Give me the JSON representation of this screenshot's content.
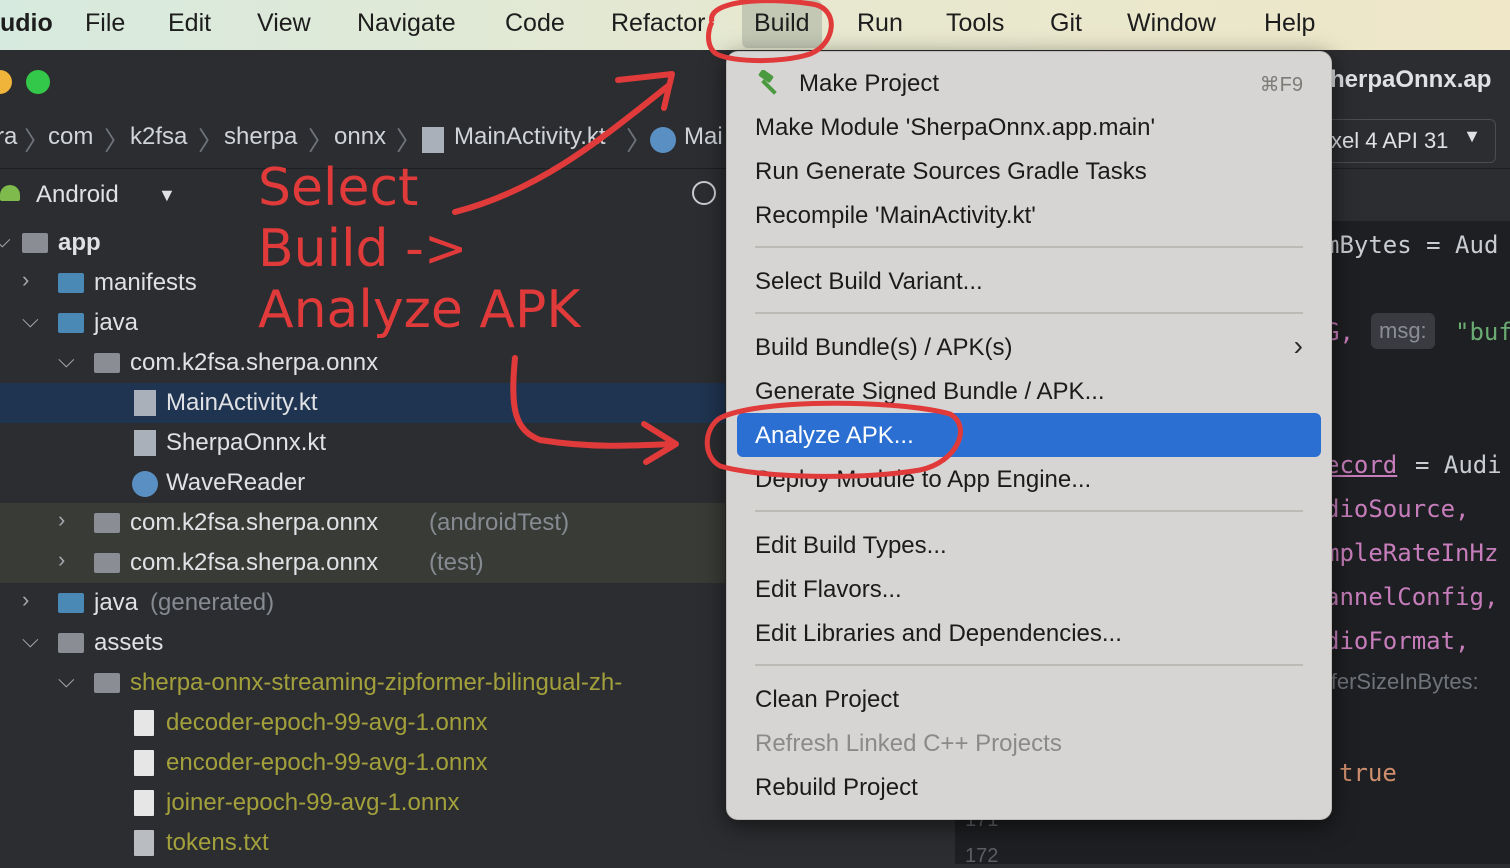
{
  "menubar": {
    "app": "udio",
    "items": [
      "File",
      "Edit",
      "View",
      "Navigate",
      "Code",
      "Refactor",
      "Build",
      "Run",
      "Tools",
      "Git",
      "Window",
      "Help"
    ]
  },
  "breadcrumb": [
    "ra",
    "com",
    "k2fsa",
    "sherpa",
    "onnx",
    "MainActivity.kt",
    "Mai"
  ],
  "editor_tab": "herpaOnnx.ap",
  "device_selector": "xel 4 API 31",
  "project_view": {
    "label": "Android"
  },
  "tree": [
    {
      "label": "app"
    },
    {
      "label": "manifests"
    },
    {
      "label": "java"
    },
    {
      "label": "com.k2fsa.sherpa.onnx"
    },
    {
      "label": "MainActivity.kt"
    },
    {
      "label": "SherpaOnnx.kt"
    },
    {
      "label": "WaveReader"
    },
    {
      "label": "com.k2fsa.sherpa.onnx",
      "suffix": "(androidTest)"
    },
    {
      "label": "com.k2fsa.sherpa.onnx",
      "suffix": "(test)"
    },
    {
      "label": "java",
      "suffix": "(generated)"
    },
    {
      "label": "assets"
    },
    {
      "label": "sherpa-onnx-streaming-zipformer-bilingual-zh-"
    },
    {
      "label": "decoder-epoch-99-avg-1.onnx"
    },
    {
      "label": "encoder-epoch-99-avg-1.onnx"
    },
    {
      "label": "joiner-epoch-99-avg-1.onnx"
    },
    {
      "label": "tokens.txt"
    }
  ],
  "code_lines": [
    "mBytes = Aud",
    "G,",
    "msg:",
    "\"buf",
    "ecord",
    "= Audi",
    "dioSource,",
    "mpleRateInHz",
    "annelConfig,",
    "dioFormat,",
    "fferSizeInBytes:",
    "true"
  ],
  "line_numbers": [
    "171",
    "172"
  ],
  "build_menu": {
    "make_project": "Make Project",
    "make_project_shortcut": "⌘F9",
    "make_module": "Make Module 'SherpaOnnx.app.main'",
    "run_gradle": "Run Generate Sources Gradle Tasks",
    "recompile": "Recompile 'MainActivity.kt'",
    "select_variant": "Select Build Variant...",
    "build_bundle": "Build Bundle(s) / APK(s)",
    "generate_signed": "Generate Signed Bundle / APK...",
    "analyze_apk": "Analyze APK...",
    "deploy_module": "Deploy Module to App Engine...",
    "edit_build_types": "Edit Build Types...",
    "edit_flavors": "Edit Flavors...",
    "edit_libraries": "Edit Libraries and Dependencies...",
    "clean_project": "Clean Project",
    "refresh_linked": "Refresh Linked C++ Projects",
    "rebuild_project": "Rebuild Project"
  },
  "annotation": {
    "line1": "Select",
    "line2": "Build ->",
    "line3": "Analyze APK"
  },
  "colors": {
    "highlight": "#2b6fd3",
    "annotation": "#e03a3a",
    "menubar": "#e4e8d2"
  }
}
